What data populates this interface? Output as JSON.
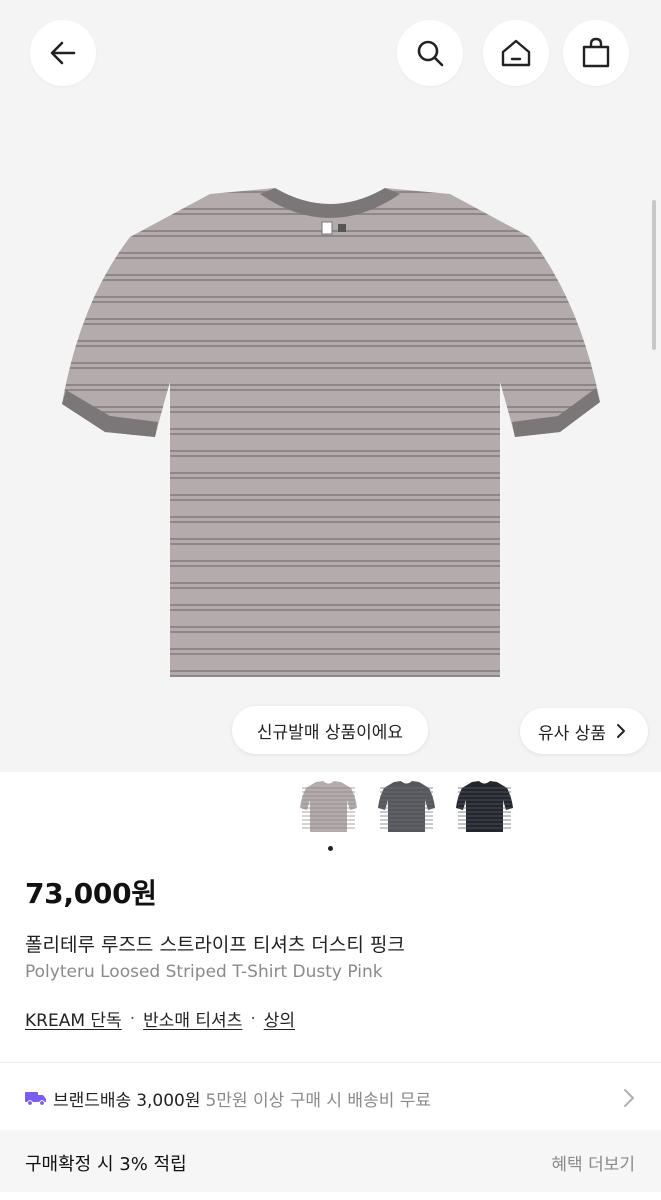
{
  "header": {
    "back_icon": "arrow-left-icon",
    "search_icon": "search-icon",
    "home_icon": "home-icon",
    "cart_icon": "shopping-bag-icon"
  },
  "product_image": {
    "badges": {
      "new_release": "신규발매 상품이에요",
      "similar": "유사 상품"
    },
    "thumbnails": [
      {
        "color_name": "dusty-pink",
        "color": "#b3abac",
        "stripe": "#8e8789"
      },
      {
        "color_name": "charcoal",
        "color": "#55575c",
        "stripe": "#6e7076"
      },
      {
        "color_name": "navy-black",
        "color": "#23262d",
        "stripe": "#5b5e66"
      }
    ],
    "active_index": 0
  },
  "product": {
    "price": "73,000원",
    "name_ko": "폴리테루 루즈드 스트라이프 티셔츠 더스티 핑크",
    "name_en": "Polyteru Loosed Striped T-Shirt Dusty Pink",
    "tags": [
      "KREAM 단독",
      "반소매 티셔츠",
      "상의"
    ]
  },
  "shipping": {
    "label": "브랜드배송",
    "fee": "3,000원",
    "note": "5만원 이상 구매 시 배송비 무료"
  },
  "reward": {
    "title": "구매확정 시 3% 적립",
    "more": "혜택 더보기"
  },
  "colors": {
    "hero_bg": "#f4f4f4",
    "shirt_body": "#b3abac",
    "shirt_trim": "#7b7677",
    "shipping_truck": "#7b5cf0"
  }
}
